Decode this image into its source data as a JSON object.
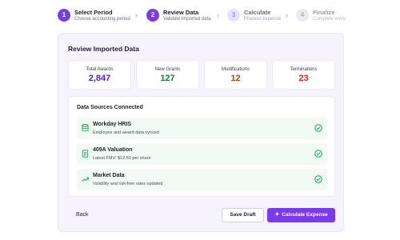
{
  "stepper": {
    "steps": [
      {
        "number": "1",
        "title": "Select Period",
        "subtitle": "Choose accounting period"
      },
      {
        "number": "2",
        "title": "Review Data",
        "subtitle": "Validate imported data"
      },
      {
        "number": "3",
        "title": "Calculate",
        "subtitle": "Process expense"
      },
      {
        "number": "4",
        "title": "Finalize",
        "subtitle": "Complete entry"
      }
    ]
  },
  "panel": {
    "title": "Review Imported Data",
    "stats": [
      {
        "label": "Total Awards",
        "value": "2,847",
        "color": "#5b21b6"
      },
      {
        "label": "New Grants",
        "value": "127",
        "color": "#15803d"
      },
      {
        "label": "Modifications",
        "value": "12",
        "color": "#c2410c"
      },
      {
        "label": "Terminations",
        "value": "23",
        "color": "#dc2626"
      }
    ],
    "sources": {
      "title": "Data Sources Connected",
      "items": [
        {
          "name": "Workday HRIS",
          "description": "Employee and award data synced",
          "icon": "database-icon"
        },
        {
          "name": "409A Valuation",
          "description": "Latest FMV: $12.50 per share",
          "icon": "document-icon"
        },
        {
          "name": "Market Data",
          "description": "Volatility and risk-free rates updated",
          "icon": "trend-icon"
        }
      ]
    }
  },
  "actions": {
    "back_label": "Back",
    "save_label": "Save Draft",
    "calculate_label": "Calculate Expense"
  },
  "colors": {
    "accent": "#7c3aed",
    "success": "#16a34a",
    "source_bg": "#f1fbf4"
  }
}
